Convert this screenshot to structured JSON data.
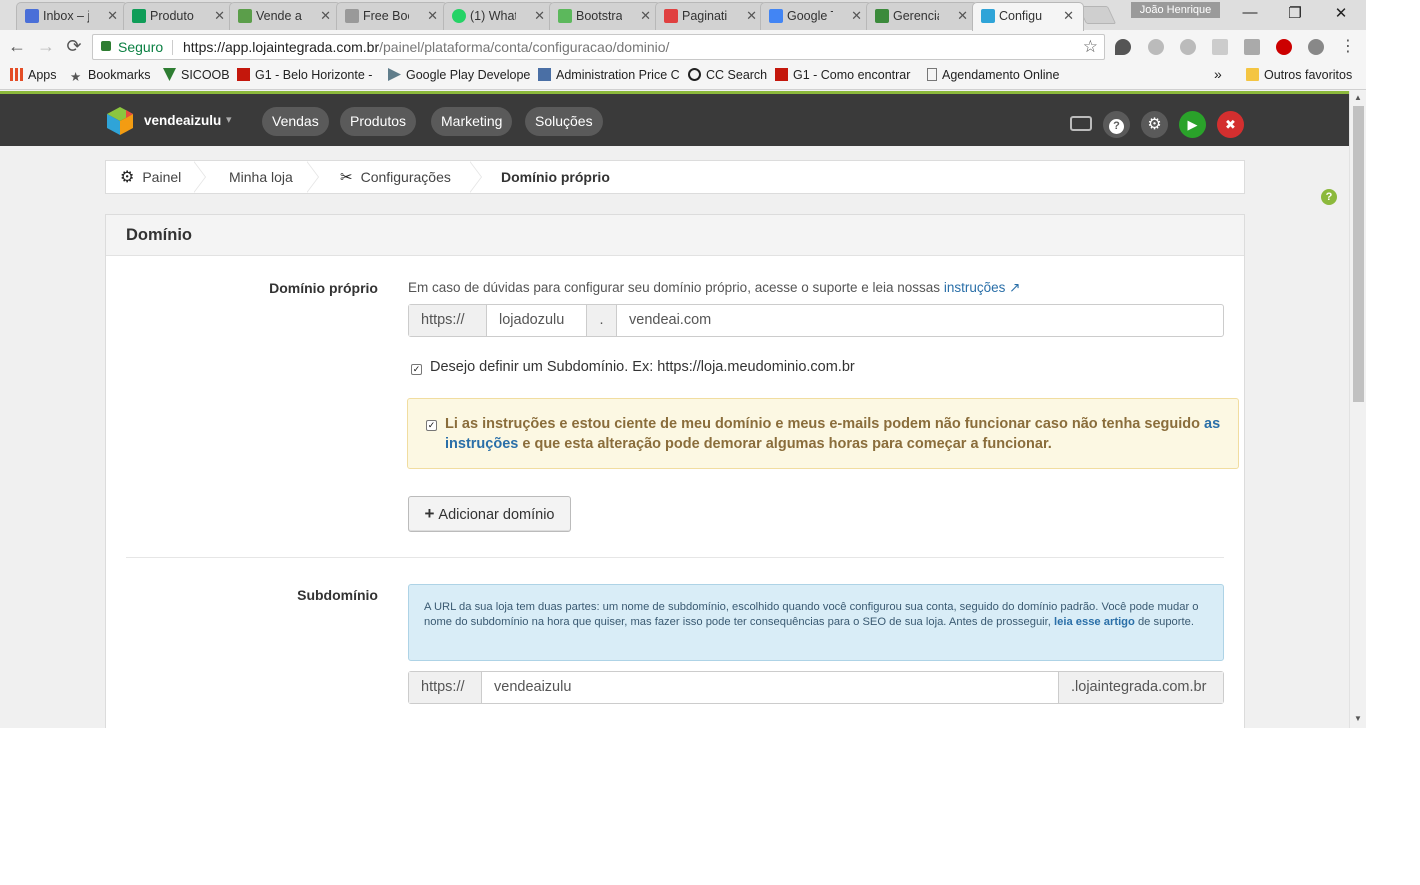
{
  "browser": {
    "tabs": [
      {
        "label": "Inbox – j",
        "favicon_color": "#4a6fd8"
      },
      {
        "label": "Produto",
        "favicon_color": "#0f9d58"
      },
      {
        "label": "Vende aí",
        "favicon_color": "#5b9e4a"
      },
      {
        "label": "Free Boo",
        "favicon_color": "#999999"
      },
      {
        "label": "(1) What",
        "favicon_color": "#25d366"
      },
      {
        "label": "Bootstra",
        "favicon_color": "#5cb85c"
      },
      {
        "label": "Paginati",
        "favicon_color": "#e04040"
      },
      {
        "label": "Google T",
        "favicon_color": "#4285f4"
      },
      {
        "label": "Gerencia",
        "favicon_color": "#3b8a3b"
      },
      {
        "label": "Configu",
        "favicon_color": "#2fa4d8",
        "active": true
      }
    ],
    "tab_close_glyph": "✕",
    "profile_name": "João Henrique",
    "window_controls": {
      "minimize": "—",
      "restore": "❐",
      "close": "✕"
    },
    "nav": {
      "back": "←",
      "forward": "→",
      "reload": "⟳"
    },
    "secure_label": "Seguro",
    "url_host": "https://app.lojaintegrada.com.br",
    "url_path": "/painel/plataforma/conta/configuracao/dominio/",
    "bookmark_star": "☆",
    "bookmarks": [
      {
        "label": "Apps",
        "icon": "apps-grid-icon",
        "color": "#e44d26"
      },
      {
        "label": "Bookmarks",
        "icon": "star-icon",
        "color": "#555555"
      },
      {
        "label": "SICOOB",
        "icon": "sicoob-icon",
        "color": "#2e7d32"
      },
      {
        "label": "G1 - Belo Horizonte -",
        "icon": "g1-icon",
        "color": "#c4170c"
      },
      {
        "label": "Google Play Develope",
        "icon": "play-icon",
        "color": "#555555"
      },
      {
        "label": "Administration Price C",
        "icon": "admin-icon",
        "color": "#4a6fa5"
      },
      {
        "label": "CC Search",
        "icon": "cc-icon",
        "color": "#222222"
      },
      {
        "label": "G1 - Como encontrar",
        "icon": "g1-icon",
        "color": "#c4170c"
      },
      {
        "label": "Agendamento Online",
        "icon": "page-icon",
        "color": "#777777"
      }
    ],
    "bookmarks_overflow": "»",
    "other_bookmarks": "Outros favoritos"
  },
  "app": {
    "store_name": "vendeaizulu",
    "store_caret": "▾",
    "menu": [
      "Vendas",
      "Produtos",
      "Marketing",
      "Soluções"
    ],
    "actions": {
      "help": "?",
      "settings": "⚙",
      "play": "▶",
      "close": "✖"
    },
    "colors": {
      "navbar": "#3a3a3a",
      "accent_green": "#8cb93c",
      "play_green": "#2aa22a",
      "close_red": "#d32f2f",
      "link_blue": "#2a6fa8"
    }
  },
  "breadcrumb": [
    {
      "label": "Painel",
      "icon": "gear-icon",
      "glyph": "⚙"
    },
    {
      "label": "Minha loja"
    },
    {
      "label": "Configurações",
      "icon": "tools-icon",
      "glyph": "✂"
    },
    {
      "label": "Domínio próprio",
      "current": true
    }
  ],
  "page_help_glyph": "?",
  "panel": {
    "title": "Domínio",
    "custom_domain": {
      "label": "Domínio próprio",
      "help_text": "Em caso de dúvidas para configurar seu domínio próprio, acesse o suporte e leia nossas",
      "help_link": "instruções",
      "external_link_glyph": "↗",
      "protocol": "https://",
      "subdomain_value": "lojadozulu",
      "dot": ".",
      "domain_value": "vendeai.com"
    },
    "subdomain_checkbox": {
      "checked": true,
      "label": "Desejo definir um Subdomínio. Ex: https://loja.meudominio.com.br"
    },
    "warning": {
      "checked": true,
      "text_before": "Li as instruções e estou ciente de meu domínio e meus e-mails podem não funcionar caso não tenha seguido",
      "link": "as instruções",
      "text_after": "e que esta alteração pode demorar algumas horas para começar a funcionar."
    },
    "add_domain_button": {
      "icon": "+",
      "label": "Adicionar domínio"
    },
    "subdomain": {
      "label": "Subdomínio",
      "info_text": "A URL da sua loja tem duas partes: um nome de subdomínio, escolhido quando você configurou sua conta, seguido do domínio padrão. Você pode mudar o nome do subdomínio na hora que quiser, mas fazer isso pode ter consequências para o SEO de sua loja. Antes de prosseguir,",
      "info_link": "leia esse artigo",
      "info_after": "de suporte.",
      "protocol": "https://",
      "value": "vendeaizulu",
      "suffix": ".lojaintegrada.com.br"
    }
  }
}
